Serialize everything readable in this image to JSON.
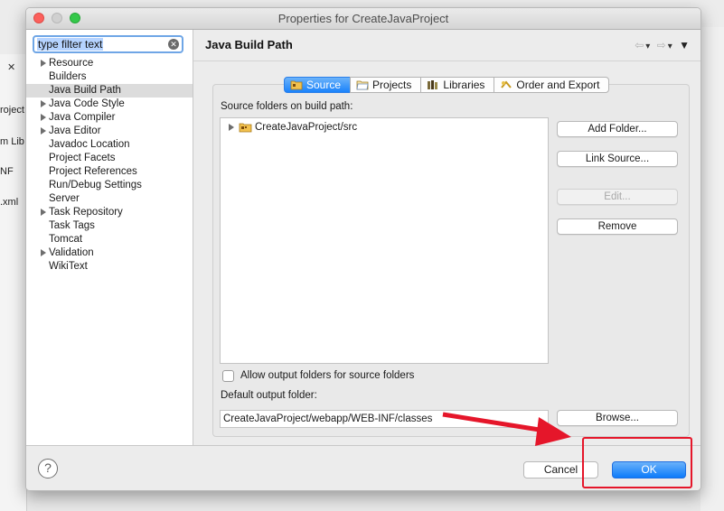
{
  "background": {
    "left_texts": [
      "roject",
      "m Lib",
      "NF",
      ".xml"
    ],
    "close_glyph": "✕"
  },
  "window": {
    "title": "Properties for CreateJavaProject"
  },
  "filter": {
    "placeholder": "type filter text",
    "value": "type filter text"
  },
  "tree": {
    "items": [
      {
        "label": "Resource",
        "expandable": true
      },
      {
        "label": "Builders",
        "expandable": false
      },
      {
        "label": "Java Build Path",
        "expandable": false,
        "selected": true
      },
      {
        "label": "Java Code Style",
        "expandable": true
      },
      {
        "label": "Java Compiler",
        "expandable": true
      },
      {
        "label": "Java Editor",
        "expandable": true
      },
      {
        "label": "Javadoc Location",
        "expandable": false
      },
      {
        "label": "Project Facets",
        "expandable": false
      },
      {
        "label": "Project References",
        "expandable": false
      },
      {
        "label": "Run/Debug Settings",
        "expandable": false
      },
      {
        "label": "Server",
        "expandable": false
      },
      {
        "label": "Task Repository",
        "expandable": true
      },
      {
        "label": "Task Tags",
        "expandable": false
      },
      {
        "label": "Tomcat",
        "expandable": false
      },
      {
        "label": "Validation",
        "expandable": true
      },
      {
        "label": "WikiText",
        "expandable": false
      }
    ]
  },
  "page": {
    "title": "Java Build Path",
    "tabs": [
      {
        "label": "Source",
        "icon": "source-folder-icon",
        "active": true
      },
      {
        "label": "Projects",
        "icon": "folder-icon",
        "active": false
      },
      {
        "label": "Libraries",
        "icon": "library-icon",
        "active": false
      },
      {
        "label": "Order and Export",
        "icon": "order-export-icon",
        "active": false
      }
    ],
    "source_folders_label": "Source folders on build path:",
    "source_folders": [
      "CreateJavaProject/src"
    ],
    "buttons": {
      "add_folder": "Add Folder...",
      "link_source": "Link Source...",
      "edit": "Edit...",
      "remove": "Remove",
      "browse": "Browse..."
    },
    "allow_output_label": "Allow output folders for source folders",
    "default_output_label": "Default output folder:",
    "default_output_value": "CreateJavaProject/webapp/WEB-INF/classes"
  },
  "footer": {
    "help_glyph": "?",
    "cancel": "Cancel",
    "ok": "OK"
  },
  "colors": {
    "accent": "#1a82fb",
    "annotation_red": "#e5162a"
  }
}
